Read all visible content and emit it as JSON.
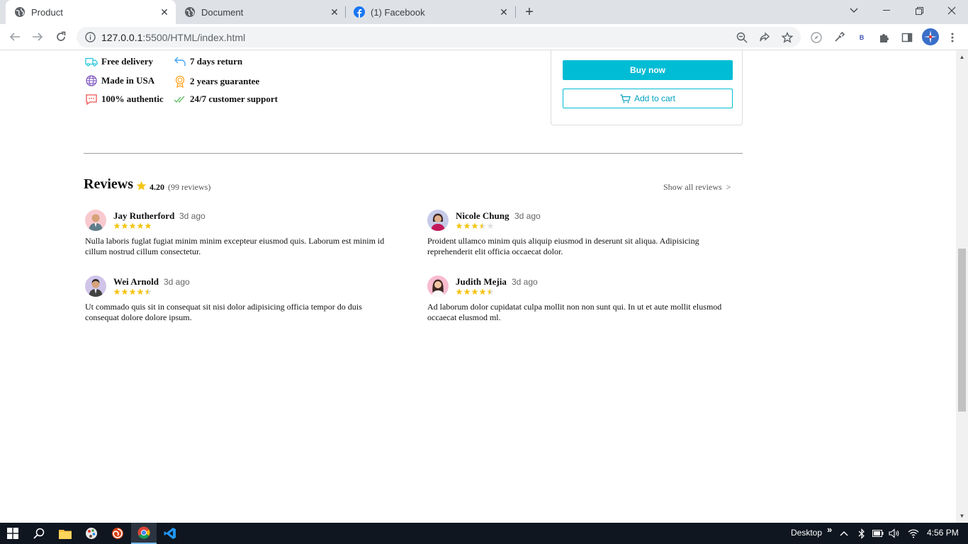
{
  "browser": {
    "tabs": [
      {
        "title": "Product",
        "favicon": "globe-icon",
        "active": true
      },
      {
        "title": "Document",
        "favicon": "globe-icon",
        "active": false
      },
      {
        "title": "(1) Facebook",
        "favicon": "facebook-icon",
        "active": false
      }
    ],
    "url_host": "127.0.0.1",
    "url_path": ":5500/HTML/index.html",
    "profile_badge": "B"
  },
  "features": [
    {
      "label": "Free delivery",
      "icon": "truck-icon",
      "color": "#26c6da"
    },
    {
      "label": "7 days return",
      "icon": "return-arrow-icon",
      "color": "#42a5f5"
    },
    {
      "label": "Made in USA",
      "icon": "globe-icon",
      "color": "#7e57c2"
    },
    {
      "label": "2 years guarantee",
      "icon": "award-icon",
      "color": "#ffa726"
    },
    {
      "label": "100% authentic",
      "icon": "chat-dots-icon",
      "color": "#ef5350"
    },
    {
      "label": "24/7 customer support",
      "icon": "double-check-icon",
      "color": "#66bb6a"
    }
  ],
  "purchase": {
    "buy_now": "Buy now",
    "add_to_cart": "Add to cart",
    "accent": "#00bcd4"
  },
  "reviews": {
    "title": "Reviews",
    "rating": "4.20",
    "count": "(99 reviews)",
    "show_all": "Show all reviews  >",
    "items": [
      {
        "name": "Jay Rutherford",
        "time": "3d ago",
        "stars": 5,
        "text": "Nulla laboris fuglat fugiat minim minim excepteur eiusmod quis. Laborum est minim id cillum nostrud cillum consectetur."
      },
      {
        "name": "Nicole Chung",
        "time": "3d ago",
        "stars": 3.5,
        "text": "Proident ullamco minim quis aliquip eiusmod in deserunt sit aliqua. Adipisicing reprehenderit elit officia occaecat dolor."
      },
      {
        "name": "Wei Arnold",
        "time": "3d ago",
        "stars": 4.5,
        "text": "Ut commado quis sit in consequat sit nisi dolor adipisicing officia tempor do duis consequat dolore dolore ipsum."
      },
      {
        "name": "Judith Mejia",
        "time": "3d ago",
        "stars": 4.5,
        "text": "Ad laborum dolor cupidatat culpa mollit non non sunt qui. In ut et aute mollit elusmod occaecat elusmod ml."
      }
    ],
    "star_color": "#f5c518",
    "star_empty_color": "#e0e0e0"
  },
  "taskbar": {
    "desktop_label": "Desktop",
    "more": "»",
    "time": "4:56 PM"
  }
}
